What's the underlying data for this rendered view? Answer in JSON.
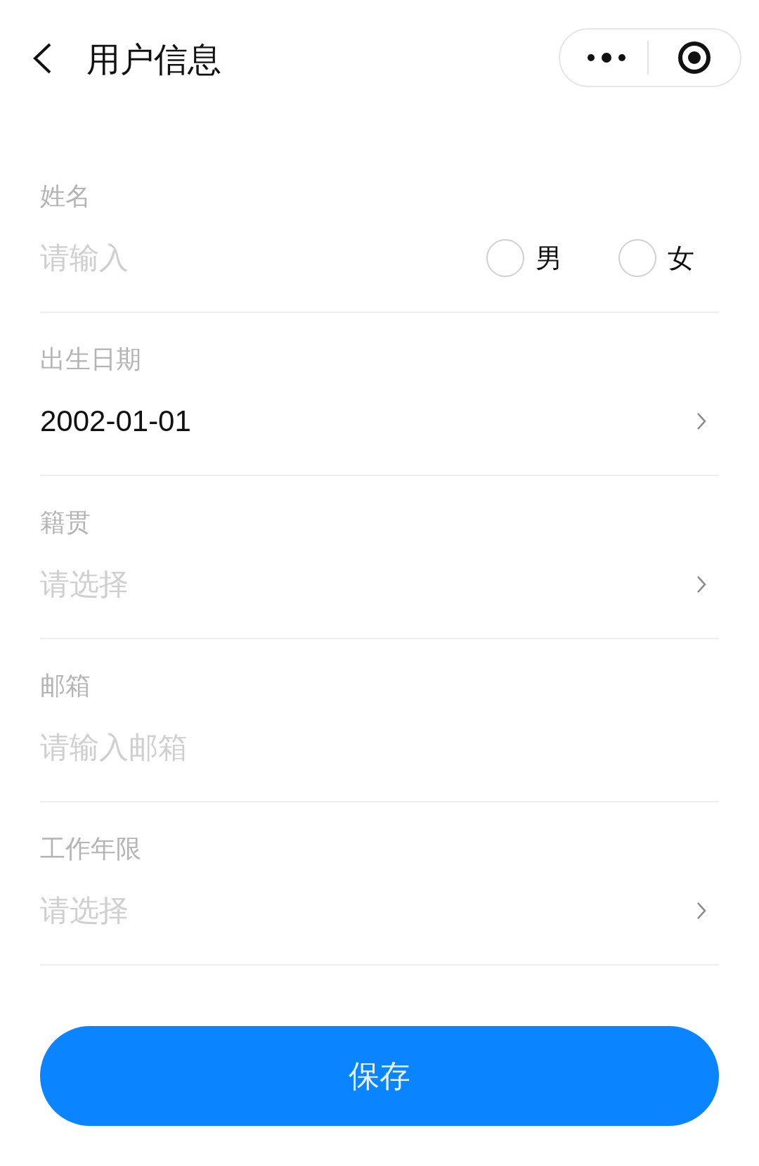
{
  "header": {
    "title": "用户信息"
  },
  "fields": [
    {
      "kind": "text",
      "label": "姓名",
      "placeholder": "请输入",
      "options": [
        {
          "label": "男",
          "selected": false
        },
        {
          "label": "女",
          "selected": false
        }
      ]
    },
    {
      "kind": "picker",
      "label": "出生日期",
      "value": "2002-01-01"
    },
    {
      "kind": "picker",
      "label": "籍贯",
      "placeholder": "请选择"
    },
    {
      "kind": "text",
      "label": "邮箱",
      "placeholder": "请输入邮箱"
    },
    {
      "kind": "picker",
      "label": "工作年限",
      "placeholder": "请选择"
    }
  ],
  "save_button": "保存"
}
